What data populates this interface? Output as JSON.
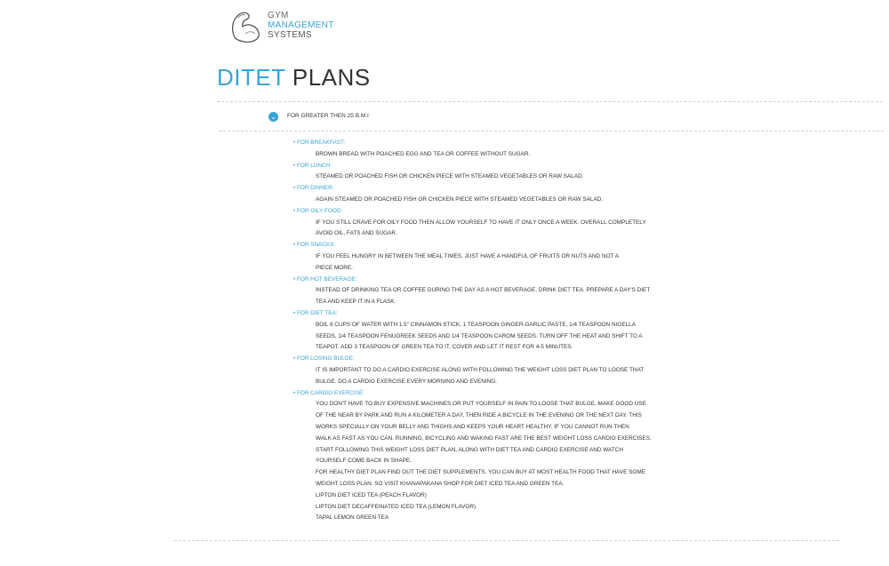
{
  "header": {
    "logo_lines": [
      "GYM",
      "MANAGEMENT",
      "SYSTEMS"
    ],
    "title_accent": "DITET",
    "title_rest": "PLANS"
  },
  "accordion": {
    "label": "FOR GREATER THEN 25 B.M.I",
    "icon": "chevron-down-icon"
  },
  "sections": [
    {
      "title": "• FOR BREAKFAST:",
      "lines": [
        "BROWN BREAD WITH POACHED EGG AND TEA OR COFFEE WITHOUT SUGAR."
      ]
    },
    {
      "title": "• FOR LUNCH:",
      "lines": [
        "STEAMED OR POACHED FISH OR CHICKEN PIECE WITH STEAMED VEGETABLES OR RAW SALAD."
      ]
    },
    {
      "title": "• FOR DINNER:",
      "lines": [
        "AGAIN STEAMED OR POACHED FISH OR CHICKEN PIECE WITH STEAMED VEGETABLES OR RAW SALAD."
      ]
    },
    {
      "title": "• FOR OILY FOOD:",
      "lines": [
        "IF YOU STILL CRAVE FOR OILY FOOD THEN ALLOW YOURSELF TO HAVE IT ONLY ONCE A WEEK. OVERALL COMPLETELY",
        "AVOID OIL, FATS AND SUGAR."
      ]
    },
    {
      "title": "• FOR SNACKS:",
      "lines": [
        "IF YOU FEEL HUNGRY IN BETWEEN THE MEAL TIMES, JUST HAVE A HANDFUL OF FRUITS OR NUTS AND NOT A",
        "PIECE MORE."
      ]
    },
    {
      "title": "• FOR HOT BEVERAGE:",
      "lines": [
        "INSTEAD OF DRINKING TEA OR COFFEE DURING THE DAY AS A HOT BEVERAGE, DRINK DIET TEA. PREPARE A DAY'S DIET",
        "TEA AND KEEP IT IN A FLASK."
      ]
    },
    {
      "title": "• FOR DIET TEA:",
      "lines": [
        "BOIL 6 CUPS OF WATER WITH 1.5\" CINNAMON STICK, 1 TEASPOON GINGER-GARLIC PASTE, 1/4 TEASPOON NIGELLA",
        "SEEDS, 1/4 TEASPOON FENUGREEK SEEDS AND 1/4 TEASPOON CAROM SEEDS. TURN OFF THE HEAT AND SHIFT TO A",
        "TEAPOT. ADD 3 TEASPOON OF GREEN TEA TO IT, COVER AND LET IT REST FOR 4-5 MINUTES."
      ]
    },
    {
      "title": "• FOR LOSING BULGE:",
      "lines": [
        " IT IS IMPORTANT TO DO A CARDIO EXERCISE ALONG WITH FOLLOWING THE WEIGHT LOSS DIET PLAN TO LOOSE THAT",
        "BULGE. DO A CARDIO EXERCISE EVERY MORNING AND EVENING."
      ]
    },
    {
      "title": "• FOR CARDIO EXERCISE:",
      "lines": [
        "YOU DON'T HAVE TO BUY EXPENSIVE MACHINES OR PUT YOURSELF IN PAIN TO LOOSE THAT BULGE. MAKE GOOD USE",
        "OF THE NEAR BY PARK AND RUN A KILOMETER A DAY, THEN RIDE A BICYCLE IN THE EVENING OR THE NEXT DAY.  THIS",
        "WORKS SPECIALLY ON YOUR BELLY AND THIGHS AND KEEPS YOUR HEART HEALTHY. IF YOU CANNOT RUN THEN",
        "WALK AS FAST AS YOU CAN. RUNNING, BICYCLING AND WAKING FAST ARE THE BEST WEIGHT LOSS CARDIO EXERCISES.",
        "START FOLLOWING THIS WEIGHT LOSS DIET PLAN, ALONG WITH DIET TEA AND CARDIO EXERCISE AND WATCH",
        "YOURSELF COME BACK IN SHAPE.",
        "FOR HEALTHY DIET PLAN FIND OUT THE DIET SUPPLEMENTS. YOU CAN BUY AT MOST HEALTH FOOD THAT HAVE SOME",
        " WEIGHT LOSS PLAN. SO VISIT KHANAPAKANA SHOP FOR DIET ICED TEA AND GREEN TEA.",
        "LIPTON DIET ICED TEA (PEACH FLAVOR)",
        "LIPTON DIET DECAFFEINATED ICED TEA (LEMON FLAVOR)",
        "TAPAL LEMON GREEN TEA"
      ]
    }
  ]
}
